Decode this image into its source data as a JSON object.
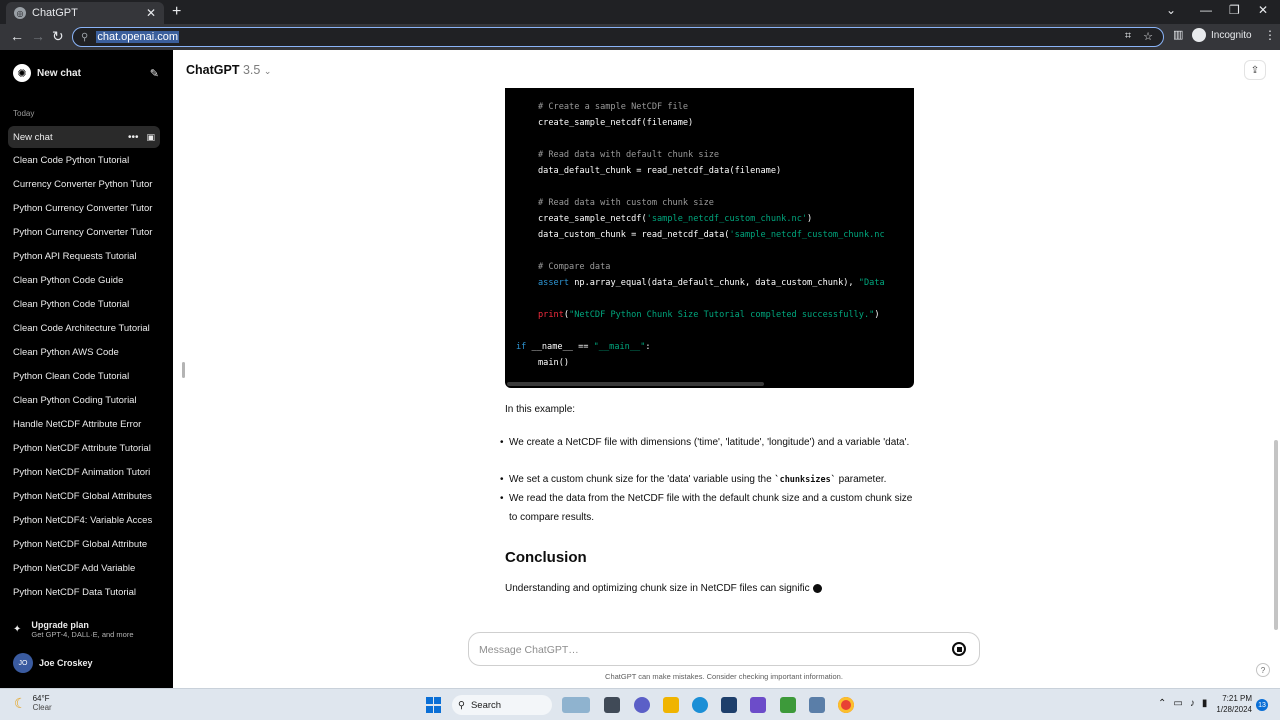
{
  "browser": {
    "tab_title": "ChatGPT",
    "url": "chat.openai.com",
    "incognito_label": "Incognito"
  },
  "sidebar": {
    "new_chat": "New chat",
    "today_label": "Today",
    "active_chat": "New chat",
    "history": [
      "Clean Code Python Tutorial",
      "Currency Converter Python Tutor",
      "Python Currency Converter Tutor",
      "Python Currency Converter Tutor",
      "Python API Requests Tutorial",
      "Clean Python Code Guide",
      "Clean Python Code Tutorial",
      "Clean Code Architecture Tutorial",
      "Clean Python AWS Code",
      "Python Clean Code Tutorial",
      "Clean Python Coding Tutorial",
      "Handle NetCDF Attribute Error",
      "Python NetCDF Attribute Tutorial",
      "Python NetCDF Animation Tutori",
      "Python NetCDF Global Attributes",
      "Python NetCDF4: Variable Acces",
      "Python NetCDF Global Attribute",
      "Python NetCDF Add Variable",
      "Python NetCDF Data Tutorial"
    ],
    "upgrade_title": "Upgrade plan",
    "upgrade_sub": "Get GPT-4, DALL·E, and more",
    "user_initials": "JO",
    "user_name": "Joe Croskey"
  },
  "header": {
    "model_name": "ChatGPT",
    "model_version": "3.5"
  },
  "code": {
    "l1": "# Create a sample NetCDF file",
    "l2": "create_sample_netcdf(filename)",
    "l3": "# Read data with default chunk size",
    "l4": "data_default_chunk = read_netcdf_data(filename)",
    "l5": "# Read data with custom chunk size",
    "l6a": "create_sample_netcdf(",
    "l6b": "'sample_netcdf_custom_chunk.nc'",
    "l6c": ")",
    "l7a": "data_custom_chunk = read_netcdf_data(",
    "l7b": "'sample_netcdf_custom_chunk.nc",
    "l8": "# Compare data",
    "l9a": "assert",
    "l9b": " np.array_equal(data_default_chunk, data_custom_chunk), ",
    "l9c": "\"Data",
    "l10a": "print",
    "l10b": "(",
    "l10c": "\"NetCDF Python Chunk Size Tutorial completed successfully.\"",
    "l10d": ")",
    "l11a": "if",
    "l11b": " __name__ == ",
    "l11c": "\"__main__\"",
    "l11d": ":",
    "l12": "main()"
  },
  "content": {
    "intro": "In this example:",
    "b1": "We create a NetCDF file with dimensions ('time', 'latitude', 'longitude') and a variable 'data'.",
    "b2a": "We set a custom chunk size for the 'data' variable using the ",
    "b2code": "`chunksizes`",
    "b2b": " parameter.",
    "b3": "We read the data from the NetCDF file with the default chunk size and a custom chunk size to compare results.",
    "heading": "Conclusion",
    "conclusion": "Understanding and optimizing chunk size in NetCDF files can signific"
  },
  "composer": {
    "placeholder": "Message ChatGPT…",
    "disclaimer": "ChatGPT can make mistakes. Consider checking important information.",
    "help": "?"
  },
  "taskbar": {
    "temp": "64°F",
    "condition": "Clear",
    "search": "Search",
    "time": "7:21 PM",
    "date": "1/28/2024",
    "notifications": "13"
  }
}
